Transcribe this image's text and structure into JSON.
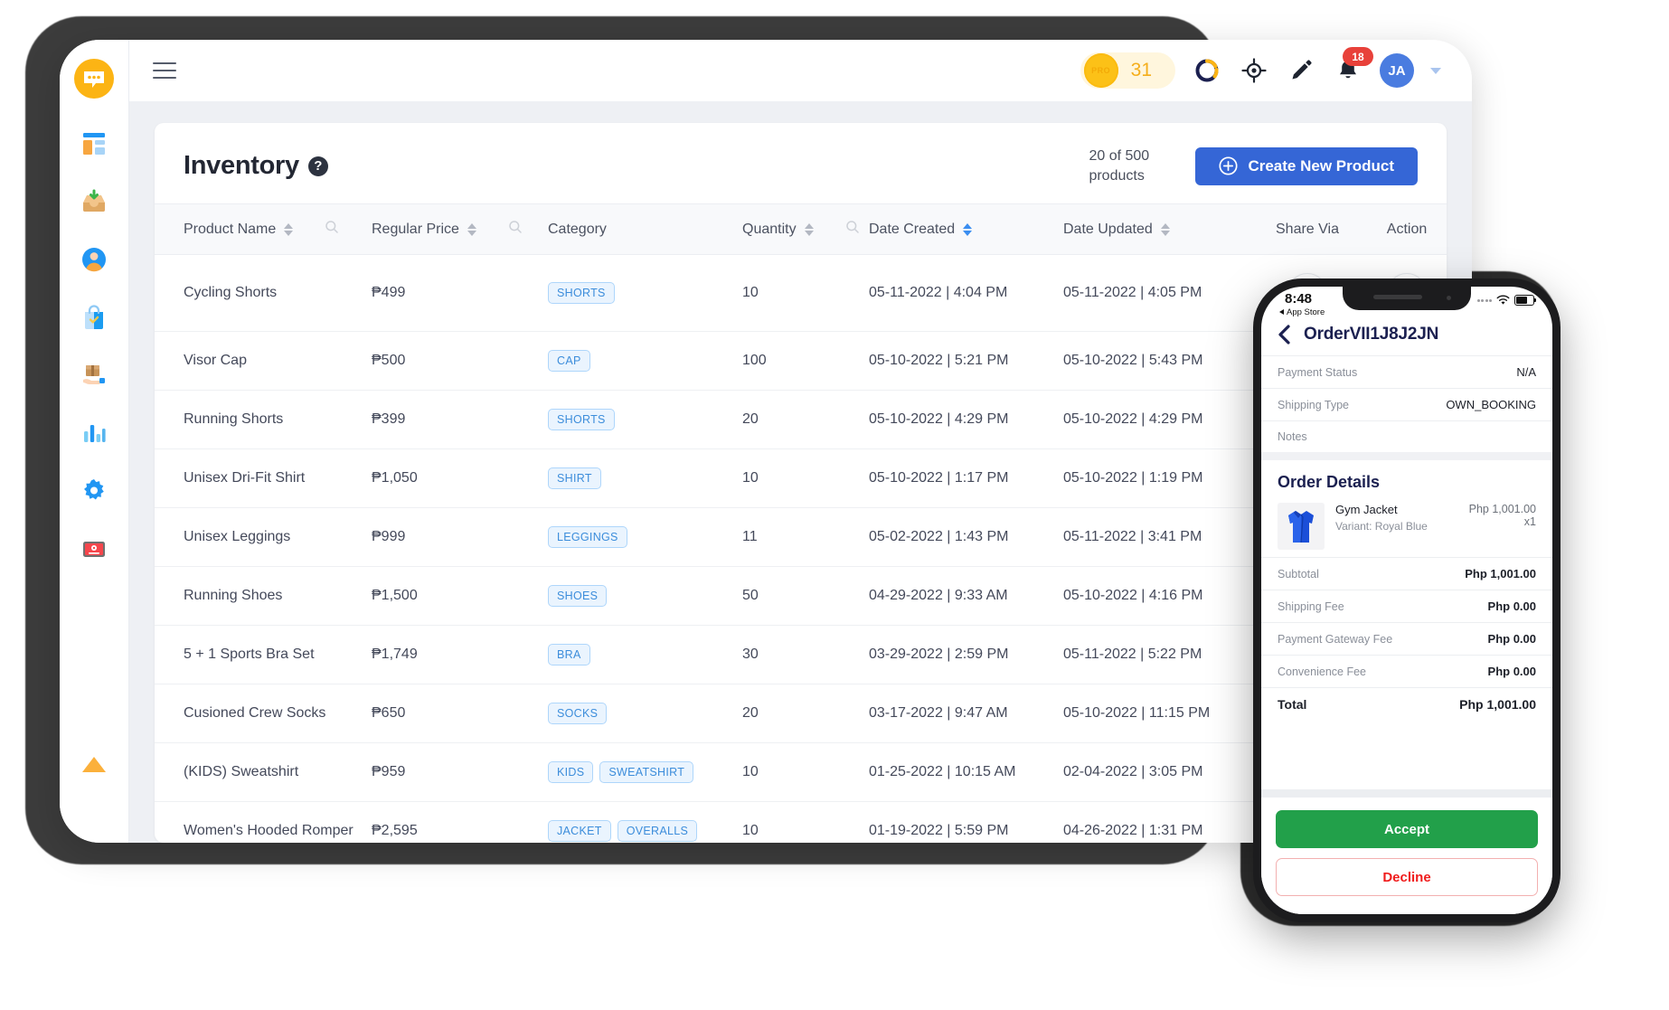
{
  "sidebar": {
    "logo_name": "chat-logo",
    "items": [
      {
        "name": "dashboard",
        "label": "Dashboard"
      },
      {
        "name": "inbox",
        "label": "Inbox"
      },
      {
        "name": "customers",
        "label": "Customers"
      },
      {
        "name": "shop",
        "label": "Shop"
      },
      {
        "name": "orders",
        "label": "Orders"
      },
      {
        "name": "analytics",
        "label": "Analytics"
      },
      {
        "name": "settings",
        "label": "Settings"
      },
      {
        "name": "tutorials",
        "label": "Tutorials"
      }
    ],
    "collapse_label": "Collapse"
  },
  "topbar": {
    "menu_label": "Menu",
    "coin_badge_text": "PRO",
    "coin_count": "31",
    "progress_label": "Progress",
    "target_label": "Target",
    "edit_label": "Edit",
    "notification_count": "18",
    "avatar_initials": "JA"
  },
  "page": {
    "title": "Inventory",
    "help_glyph": "?",
    "count_text": "20 of 500 products",
    "create_button": "Create New Product"
  },
  "table": {
    "columns": [
      {
        "key": "name",
        "label": "Product Name",
        "sortable": true,
        "searchable": true,
        "sort_active": false
      },
      {
        "key": "price",
        "label": "Regular Price",
        "sortable": true,
        "searchable": true,
        "sort_active": false
      },
      {
        "key": "category",
        "label": "Category",
        "sortable": false,
        "searchable": false,
        "sort_active": false
      },
      {
        "key": "quantity",
        "label": "Quantity",
        "sortable": true,
        "searchable": true,
        "sort_active": false
      },
      {
        "key": "created",
        "label": "Date Created",
        "sortable": true,
        "searchable": false,
        "sort_active": true
      },
      {
        "key": "updated",
        "label": "Date Updated",
        "sortable": true,
        "searchable": false,
        "sort_active": false
      },
      {
        "key": "share",
        "label": "Share Via",
        "sortable": false,
        "searchable": false,
        "sort_active": false
      },
      {
        "key": "action",
        "label": "Action",
        "sortable": false,
        "searchable": false,
        "sort_active": false
      }
    ],
    "rows": [
      {
        "name": "Cycling Shorts",
        "price": "₱499",
        "categories": [
          "SHORTS"
        ],
        "quantity": "10",
        "created": "05-11-2022 | 4:04 PM",
        "updated": "05-11-2022 | 4:05 PM"
      },
      {
        "name": "Visor Cap",
        "price": "₱500",
        "categories": [
          "CAP"
        ],
        "quantity": "100",
        "created": "05-10-2022 | 5:21 PM",
        "updated": "05-10-2022 | 5:43 PM"
      },
      {
        "name": "Running Shorts",
        "price": "₱399",
        "categories": [
          "SHORTS"
        ],
        "quantity": "20",
        "created": "05-10-2022 | 4:29 PM",
        "updated": "05-10-2022 | 4:29 PM"
      },
      {
        "name": "Unisex Dri-Fit Shirt",
        "price": "₱1,050",
        "categories": [
          "SHIRT"
        ],
        "quantity": "10",
        "created": "05-10-2022 | 1:17 PM",
        "updated": "05-10-2022 | 1:19 PM"
      },
      {
        "name": "Unisex Leggings",
        "price": "₱999",
        "categories": [
          "LEGGINGS"
        ],
        "quantity": "11",
        "created": "05-02-2022 | 1:43 PM",
        "updated": "05-11-2022 | 3:41 PM"
      },
      {
        "name": "Running Shoes",
        "price": "₱1,500",
        "categories": [
          "SHOES"
        ],
        "quantity": "50",
        "created": "04-29-2022 | 9:33 AM",
        "updated": "05-10-2022 | 4:16 PM"
      },
      {
        "name": "5 + 1 Sports Bra Set",
        "price": "₱1,749",
        "categories": [
          "BRA"
        ],
        "quantity": "30",
        "created": "03-29-2022 | 2:59 PM",
        "updated": "05-11-2022 | 5:22 PM"
      },
      {
        "name": "Cusioned Crew Socks",
        "price": "₱650",
        "categories": [
          "SOCKS"
        ],
        "quantity": "20",
        "created": "03-17-2022 | 9:47 AM",
        "updated": "05-10-2022 | 11:15 PM"
      },
      {
        "name": "(KIDS) Sweatshirt",
        "price": "₱959",
        "categories": [
          "KIDS",
          "SWEATSHIRT"
        ],
        "quantity": "10",
        "created": "01-25-2022 | 10:15 AM",
        "updated": "02-04-2022 | 3:05 PM"
      },
      {
        "name": "Women's Hooded Romper",
        "price": "₱2,595",
        "categories": [
          "JACKET",
          "OVERALLS"
        ],
        "quantity": "10",
        "created": "01-19-2022 | 5:59 PM",
        "updated": "04-26-2022 | 1:31 PM"
      }
    ],
    "share_label": "Share",
    "action_label": "More actions",
    "action_glyph": "···"
  },
  "phone": {
    "status": {
      "time": "8:48",
      "return_app": "App Store"
    },
    "order_id": "OrderVII1J8J2JN",
    "back_label": "Back",
    "info_rows": [
      {
        "key": "Payment Status",
        "value": "N/A"
      },
      {
        "key": "Shipping Type",
        "value": "OWN_BOOKING"
      },
      {
        "key": "Notes",
        "value": ""
      }
    ],
    "order_details_title": "Order Details",
    "item": {
      "name": "Gym Jacket",
      "variant": "Variant: Royal Blue",
      "price": "Php 1,001.00",
      "qty": "x1"
    },
    "summary": [
      {
        "key": "Subtotal",
        "value": "Php 1,001.00",
        "total": false
      },
      {
        "key": "Shipping Fee",
        "value": "Php 0.00",
        "total": false
      },
      {
        "key": "Payment Gateway Fee",
        "value": "Php 0.00",
        "total": false
      },
      {
        "key": "Convenience Fee",
        "value": "Php 0.00",
        "total": false
      },
      {
        "key": "Total",
        "value": "Php 1,001.00",
        "total": true
      }
    ],
    "accept_label": "Accept",
    "decline_label": "Decline"
  },
  "colors": {
    "primary_blue": "#3566d6",
    "accent_yellow": "#fcc117",
    "danger_red": "#e8413a",
    "success_green": "#22a04a",
    "decline_red": "#f01c1c",
    "tag_blue": "#3c8ddb"
  }
}
